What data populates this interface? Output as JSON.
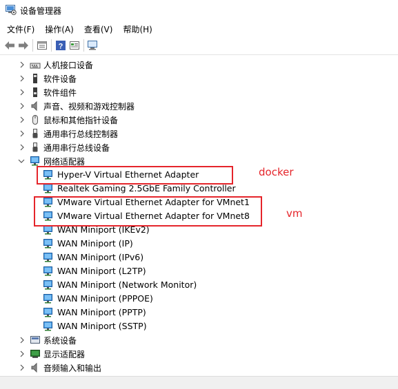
{
  "window": {
    "title": "设备管理器"
  },
  "menu": [
    "文件(F)",
    "操作(A)",
    "查看(V)",
    "帮助(H)"
  ],
  "toolbar": [
    "back-icon",
    "forward-icon",
    "properties-icon",
    "help-icon",
    "view-icon",
    "scan-hardware-icon"
  ],
  "tree": {
    "categories_top": [
      {
        "label": "人机接口设备",
        "icon": "hid-icon",
        "state": "collapsed"
      },
      {
        "label": "软件设备",
        "icon": "software-device-icon",
        "state": "collapsed"
      },
      {
        "label": "软件组件",
        "icon": "software-component-icon",
        "state": "collapsed"
      },
      {
        "label": "声音、视频和游戏控制器",
        "icon": "speaker-icon",
        "state": "collapsed"
      },
      {
        "label": "鼠标和其他指针设备",
        "icon": "mouse-icon",
        "state": "collapsed"
      },
      {
        "label": "通用串行总线控制器",
        "icon": "usb-icon",
        "state": "collapsed"
      },
      {
        "label": "通用串行总线设备",
        "icon": "usb-icon",
        "state": "collapsed"
      },
      {
        "label": "网络适配器",
        "icon": "network-adapter-icon",
        "state": "expanded"
      }
    ],
    "network_adapters": [
      "Hyper-V Virtual Ethernet Adapter",
      "Realtek Gaming 2.5GbE Family Controller",
      "VMware Virtual Ethernet Adapter for VMnet1",
      "VMware Virtual Ethernet Adapter for VMnet8",
      "WAN Miniport (IKEv2)",
      "WAN Miniport (IP)",
      "WAN Miniport (IPv6)",
      "WAN Miniport (L2TP)",
      "WAN Miniport (Network Monitor)",
      "WAN Miniport (PPPOE)",
      "WAN Miniport (PPTP)",
      "WAN Miniport (SSTP)"
    ],
    "categories_bottom": [
      {
        "label": "系统设备",
        "icon": "system-device-icon",
        "state": "collapsed"
      },
      {
        "label": "显示适配器",
        "icon": "display-adapter-icon",
        "state": "collapsed"
      },
      {
        "label": "音频输入和输出",
        "icon": "audio-io-icon",
        "state": "collapsed"
      }
    ]
  },
  "annotations": [
    {
      "label": "docker"
    },
    {
      "label": "vm"
    }
  ],
  "colors": {
    "annotation": "#e5242a",
    "adapter_icon": "#1e78c8"
  }
}
